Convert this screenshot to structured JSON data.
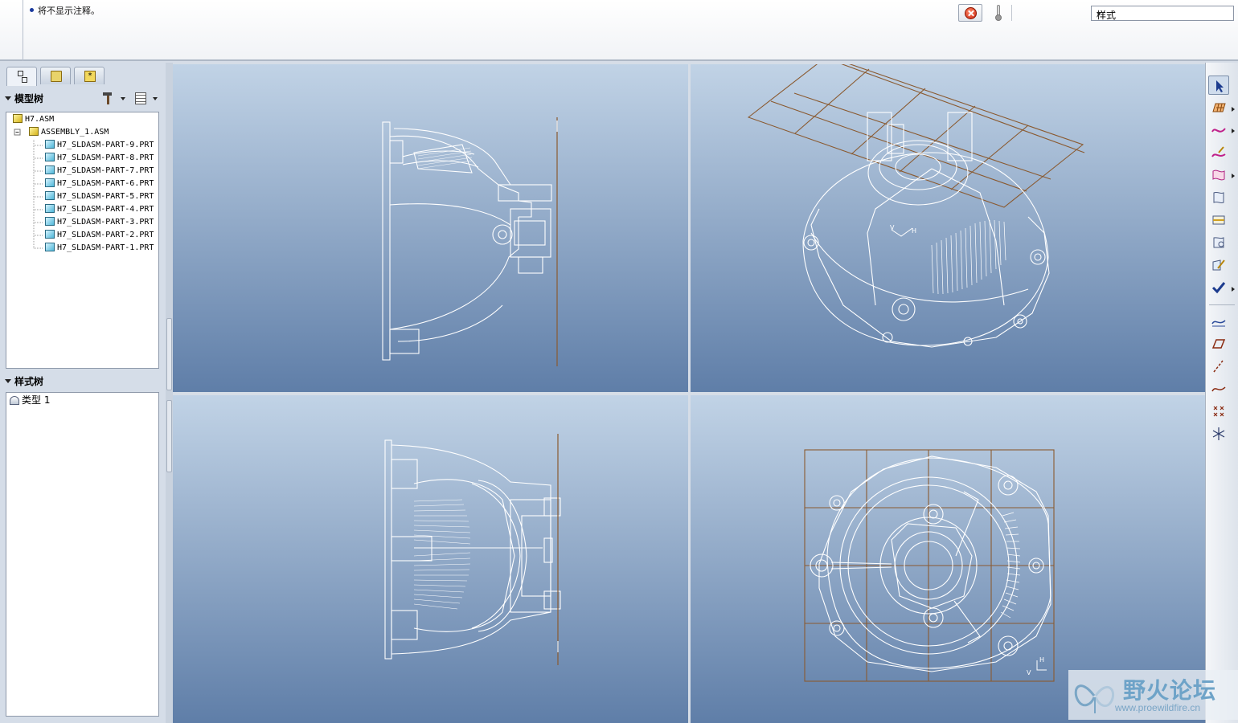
{
  "message": {
    "text": "将不显示注释。"
  },
  "filter": {
    "selected": "样式"
  },
  "navigator": {
    "tabs": [
      "model-tree",
      "folder-browser",
      "favorites"
    ],
    "model_tree_title": "模型树",
    "style_tree_title": "样式树",
    "model_tree": [
      {
        "label": "H7.ASM",
        "kind": "asm"
      },
      {
        "label": "ASSEMBLY_1.ASM",
        "kind": "asm"
      },
      {
        "label": "H7_SLDASM-PART-9.PRT",
        "kind": "prt"
      },
      {
        "label": "H7_SLDASM-PART-8.PRT",
        "kind": "prt"
      },
      {
        "label": "H7_SLDASM-PART-7.PRT",
        "kind": "prt"
      },
      {
        "label": "H7_SLDASM-PART-6.PRT",
        "kind": "prt"
      },
      {
        "label": "H7_SLDASM-PART-5.PRT",
        "kind": "prt"
      },
      {
        "label": "H7_SLDASM-PART-4.PRT",
        "kind": "prt"
      },
      {
        "label": "H7_SLDASM-PART-3.PRT",
        "kind": "prt"
      },
      {
        "label": "H7_SLDASM-PART-2.PRT",
        "kind": "prt"
      },
      {
        "label": "H7_SLDASM-PART-1.PRT",
        "kind": "prt"
      }
    ],
    "style_tree": [
      {
        "label": "类型 1"
      }
    ]
  },
  "viewports": {
    "axis_label_h": "H",
    "axis_label_v": "V"
  },
  "watermark": {
    "title": "野火论坛",
    "url": "www.proewildfire.cn"
  },
  "colors": {
    "wire": "#ffffff",
    "grid": "#8a5a30",
    "viewport_top": "#c1d3e6",
    "viewport_bottom": "#5f7ea8"
  }
}
